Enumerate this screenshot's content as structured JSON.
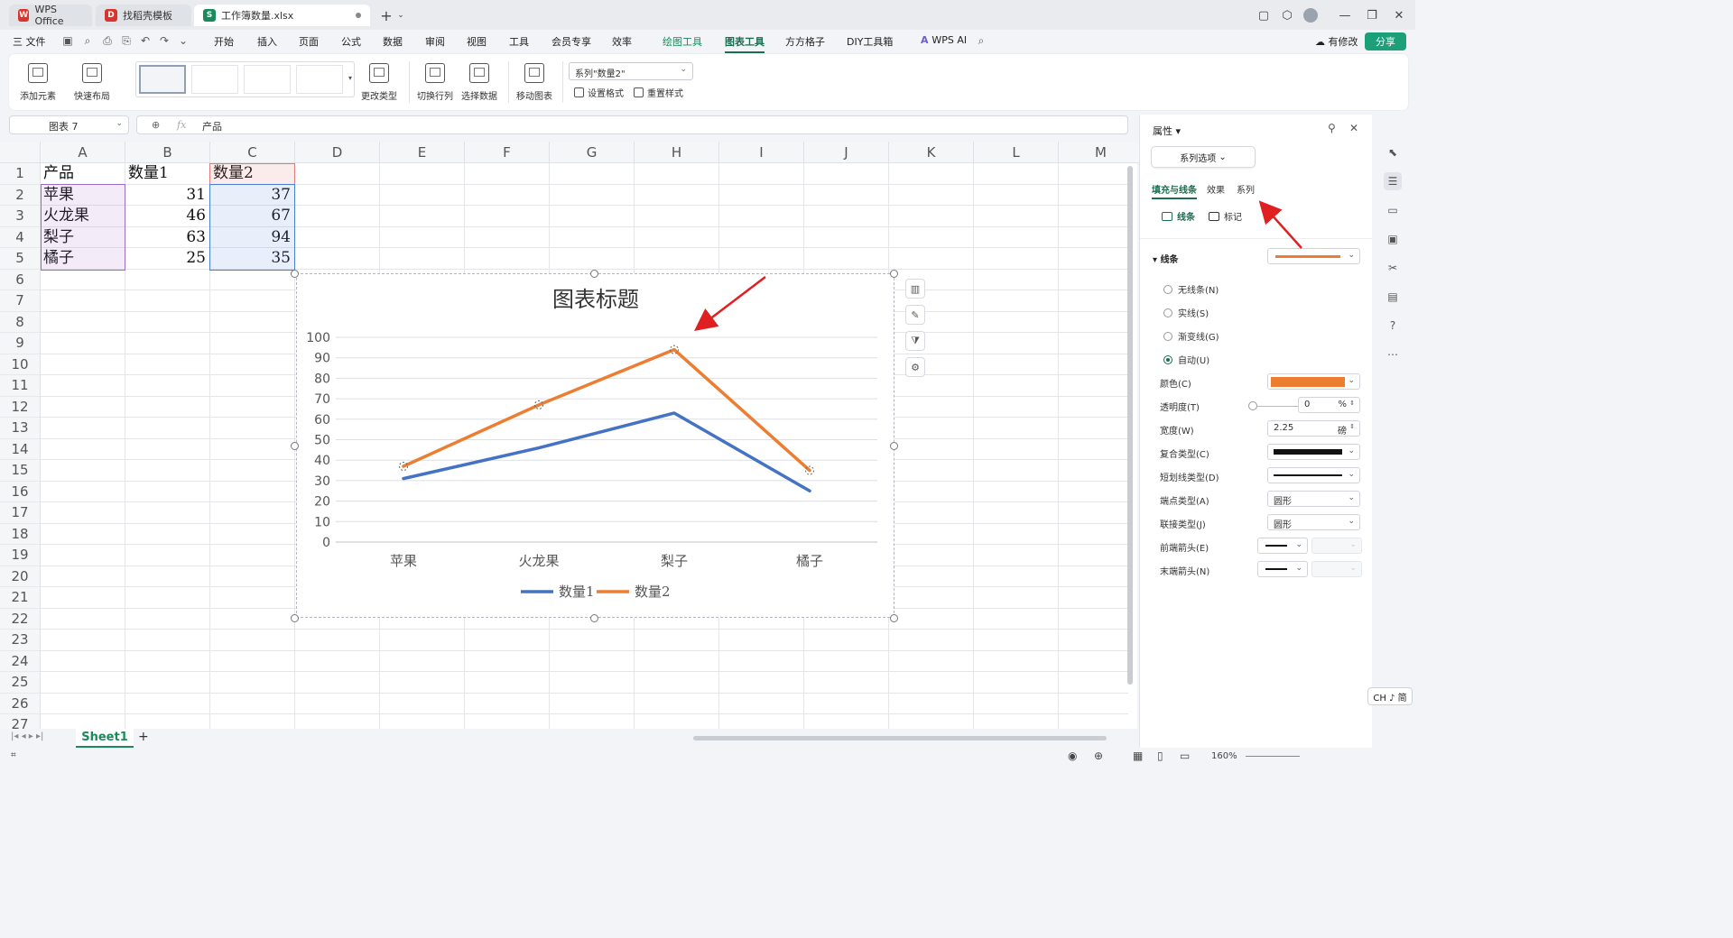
{
  "titlebar": {
    "tabs": [
      {
        "label": "WPS Office",
        "icon": "wps-logo-icon"
      },
      {
        "label": "找稻壳模板",
        "icon": "docer-icon"
      },
      {
        "label": "工作簿数量.xlsx",
        "icon": "spreadsheet-icon"
      }
    ]
  },
  "menubar": {
    "file": "三 文件",
    "items": [
      "开始",
      "插入",
      "页面",
      "公式",
      "数据",
      "审阅",
      "视图",
      "工具",
      "会员专享",
      "效率",
      "绘图工具",
      "图表工具",
      "方方格子",
      "DIY工具箱",
      "WPS AI"
    ],
    "active": "图表工具",
    "status": "有修改",
    "share": "分享"
  },
  "ribbon": {
    "add_element": "添加元素",
    "quick_layout": "快速布局",
    "change_type": "更改类型",
    "switch_rowcol": "切换行列",
    "select_data": "选择数据",
    "move_chart": "移动图表",
    "series_select": "系列\"数量2\"",
    "set_format": "设置格式",
    "reset_style": "重置样式"
  },
  "formula_bar": {
    "name_box": "图表 7",
    "fx": "fx",
    "content": "产品"
  },
  "sheet": {
    "columns": [
      "A",
      "B",
      "C",
      "D",
      "E",
      "F",
      "G",
      "H",
      "I",
      "J",
      "K",
      "L",
      "M"
    ],
    "rows": [
      "1",
      "2",
      "3",
      "4",
      "5",
      "6",
      "7",
      "8",
      "9",
      "10",
      "11",
      "12",
      "13",
      "14",
      "15",
      "16",
      "17",
      "18",
      "19",
      "20",
      "21",
      "22",
      "23",
      "24",
      "25",
      "26",
      "27"
    ],
    "header": [
      "产品",
      "数量1",
      "数量2"
    ],
    "data": [
      [
        "苹果",
        "31",
        "37"
      ],
      [
        "火龙果",
        "46",
        "67"
      ],
      [
        "梨子",
        "63",
        "94"
      ],
      [
        "橘子",
        "25",
        "35"
      ]
    ],
    "tab": "Sheet1"
  },
  "chart_data": {
    "type": "line",
    "title": "图表标题",
    "categories": [
      "苹果",
      "火龙果",
      "梨子",
      "橘子"
    ],
    "series": [
      {
        "name": "数量1",
        "values": [
          31,
          46,
          63,
          25
        ],
        "color": "#4472c4"
      },
      {
        "name": "数量2",
        "values": [
          37,
          67,
          94,
          35
        ],
        "color": "#ed7d31"
      }
    ],
    "yticks": [
      "0",
      "10",
      "20",
      "30",
      "40",
      "50",
      "60",
      "70",
      "80",
      "90",
      "100"
    ],
    "ylim": [
      0,
      100
    ],
    "grid": true,
    "legend": "bottom"
  },
  "pane": {
    "title": "属性",
    "series_options": "系列选项",
    "tabs": [
      "填充与线条",
      "效果",
      "系列"
    ],
    "subtabs": [
      "线条",
      "标记"
    ],
    "section": "线条",
    "radios": [
      "无线条(N)",
      "实线(S)",
      "渐变线(G)",
      "自动(U)"
    ],
    "labels": {
      "color": "颜色(C)",
      "transparency": "透明度(T)",
      "width": "宽度(W)",
      "compound": "复合类型(C)",
      "dash": "短划线类型(D)",
      "cap": "端点类型(A)",
      "join": "联接类型(J)",
      "begin_arrow": "前端箭头(E)",
      "end_arrow": "末端箭头(N)"
    },
    "values": {
      "transparency": "0",
      "transparency_unit": "%",
      "width": "2.25",
      "width_unit": "磅",
      "cap": "圆形",
      "join": "圆形"
    },
    "line_color": "#ed7d31"
  },
  "statusbar": {
    "zoom": "160%"
  },
  "ime": "CH ♪ 简"
}
